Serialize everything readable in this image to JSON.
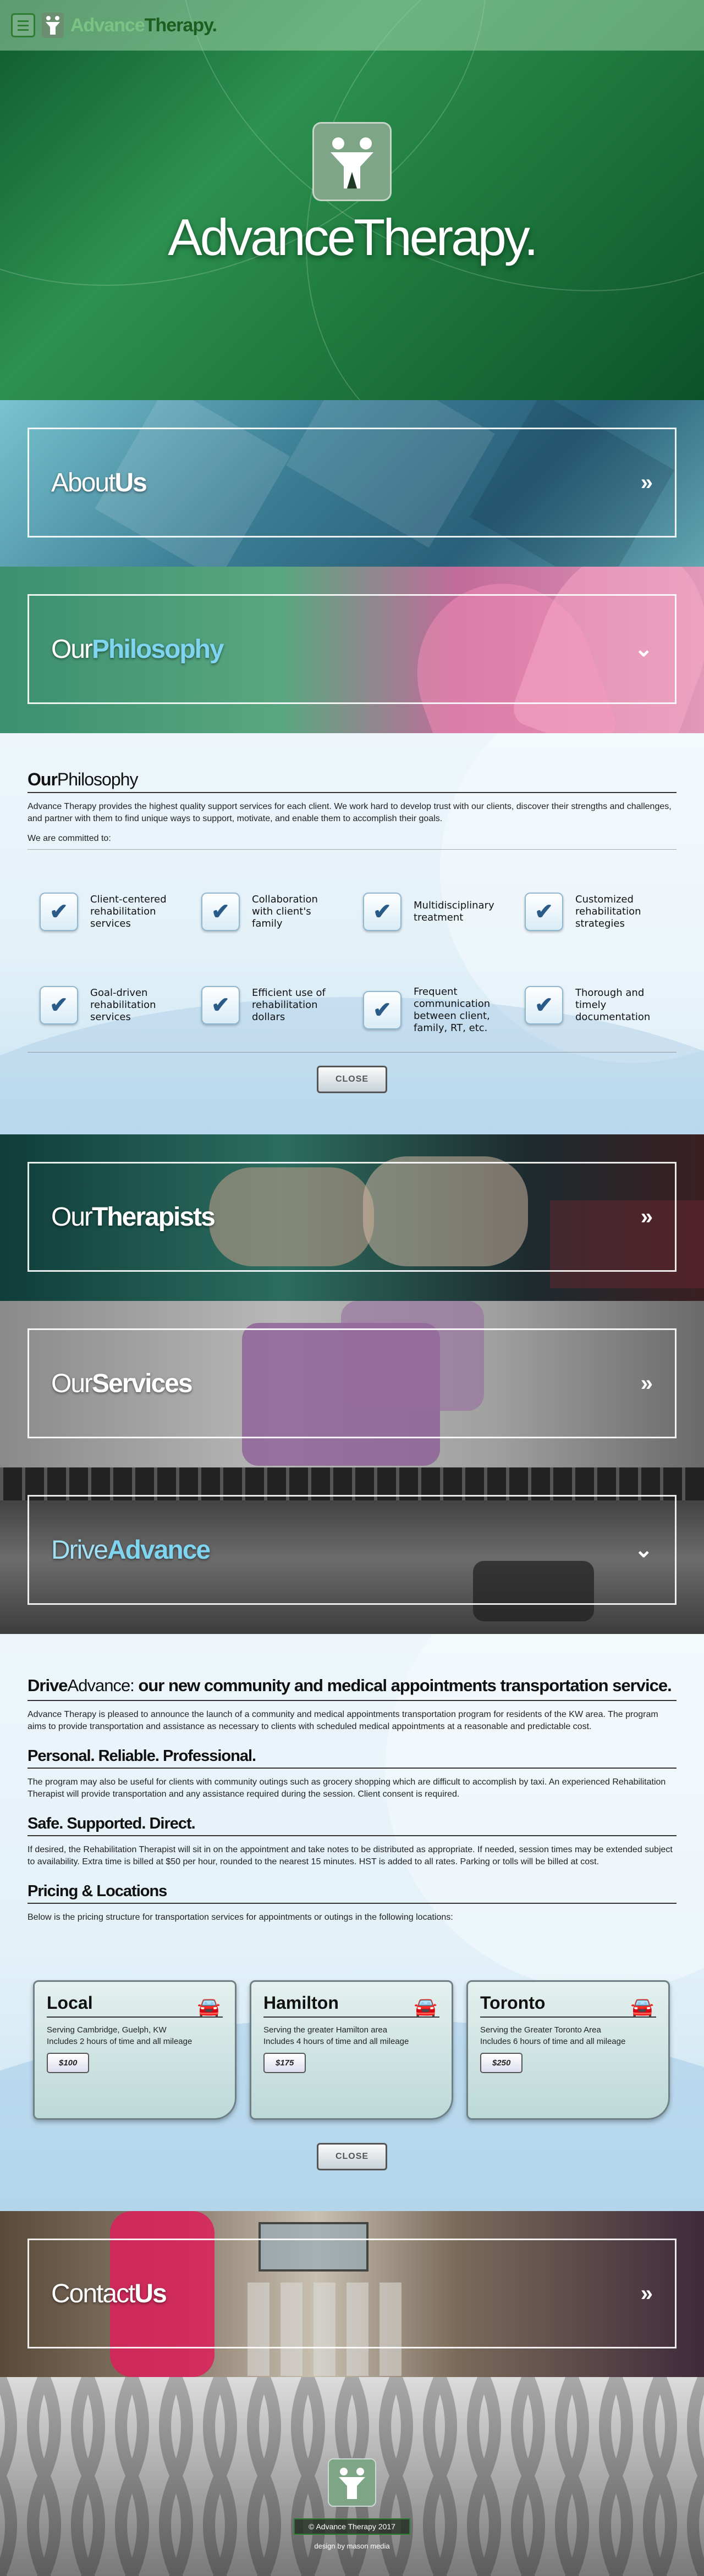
{
  "nav": {
    "brand_part1": "Advance",
    "brand_part2": "Therapy."
  },
  "hero": {
    "title": "AdvanceTherapy."
  },
  "about": {
    "thin": "About",
    "bold": "Us",
    "chev": "»"
  },
  "philosophy_banner": {
    "thin": "Our",
    "bold": "Philosophy",
    "chev": "⌄"
  },
  "philosophy": {
    "heading_bold": "Our",
    "heading_thin": "Philosophy",
    "intro": "Advance Therapy provides the highest quality support services for each client. We work hard to develop trust with our clients, discover their strengths and challenges, and partner with them to find unique ways to support, motivate, and enable them to accomplish their goals.",
    "committed": "We are committed to:",
    "items": [
      "Client-centered rehabilitation services",
      "Collaboration with client's family",
      "Multidisciplinary treatment",
      "Customized rehabilitation strategies",
      "Goal-driven rehabilitation services",
      "Efficient use of rehabilitation dollars",
      "Frequent communication between client, family, RT, etc.",
      "Thorough and timely documentation"
    ],
    "close": "CLOSE"
  },
  "therapists": {
    "thin": "Our",
    "bold": "Therapists",
    "chev": "»"
  },
  "services": {
    "thin": "Our",
    "bold": "Services",
    "chev": "»"
  },
  "drive_banner": {
    "thin": "Drive",
    "bold": "Advance",
    "chev": "⌄"
  },
  "drive": {
    "heading_bold": "Drive",
    "heading_thin": "Advance:",
    "heading_rest": " our new community and medical appointments transportation service.",
    "intro": "Advance Therapy is pleased to announce the launch of a community and medical appointments transportation program for residents of the KW area. The program aims to provide transportation and assistance as necessary to clients with scheduled medical appointments at a reasonable and predictable cost.",
    "h_personal": "Personal. Reliable. Professional.",
    "p_personal": "The program may also be useful for clients with community outings such as grocery shopping which are difficult to accomplish by taxi. An experienced Rehabilitation Therapist will provide transportation and any assistance required during the session. Client consent is required.",
    "h_safe": "Safe. Supported. Direct.",
    "p_safe": "If desired, the Rehabilitation Therapist will sit in on the appointment and take notes to be distributed as appropriate. If needed, session times may be extended subject to availability. Extra time is billed at $50 per hour, rounded to the nearest 15 minutes. HST is added to all rates. Parking or tolls will be billed at cost.",
    "h_pricing": "Pricing & Locations",
    "p_pricing": "Below is the pricing structure for transportation services for appointments or outings in the following locations:",
    "cards": [
      {
        "title": "Local",
        "line1": "Serving Cambridge, Guelph, KW",
        "line2": "Includes 2 hours of time and all mileage",
        "price": "$100"
      },
      {
        "title": "Hamilton",
        "line1": "Serving the greater Hamilton area",
        "line2": "Includes 4 hours of time and all mileage",
        "price": "$175"
      },
      {
        "title": "Toronto",
        "line1": "Serving the Greater Toronto Area",
        "line2": "Includes 6 hours of time and all mileage",
        "price": "$250"
      }
    ],
    "close": "CLOSE"
  },
  "contact": {
    "thin": "Contact",
    "bold": "Us",
    "chev": "»"
  },
  "footer": {
    "copyright": "© Advance Therapy 2017",
    "credit": "design by mason media"
  },
  "colors": {
    "brand_green": "#1b5e20",
    "accent_blue": "#2a5a88"
  }
}
